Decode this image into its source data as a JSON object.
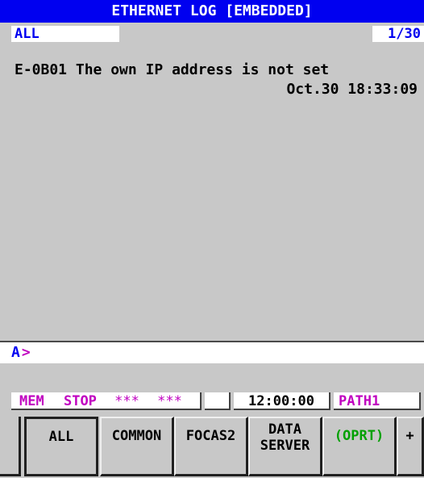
{
  "screen": {
    "title": "ETHERNET LOG [EMBEDDED]",
    "filter_label": "ALL",
    "page_indicator": "1/30"
  },
  "log": {
    "entries": [
      {
        "message": "E-0B01 The own IP address is not set",
        "timestamp": "Oct.30 18:33:09"
      }
    ]
  },
  "input": {
    "prompt": "A",
    "caret": ">"
  },
  "status": {
    "mode": "MEM",
    "run_state": "STOP",
    "alarm1": "***",
    "alarm2": "***",
    "time": "12:00:00",
    "path": "PATH1"
  },
  "softkeys": [
    {
      "label": "ALL",
      "selected": true
    },
    {
      "label": "COMMON"
    },
    {
      "label": "FOCAS2"
    },
    {
      "label": "DATA\nSERVER"
    },
    {
      "label": "(OPRT)"
    },
    {
      "label": "+"
    }
  ],
  "colors": {
    "title_bg": "#0000f0",
    "background": "#c8c8c8",
    "status_magenta": "#c000c0",
    "oprt_green": "#00a000"
  }
}
